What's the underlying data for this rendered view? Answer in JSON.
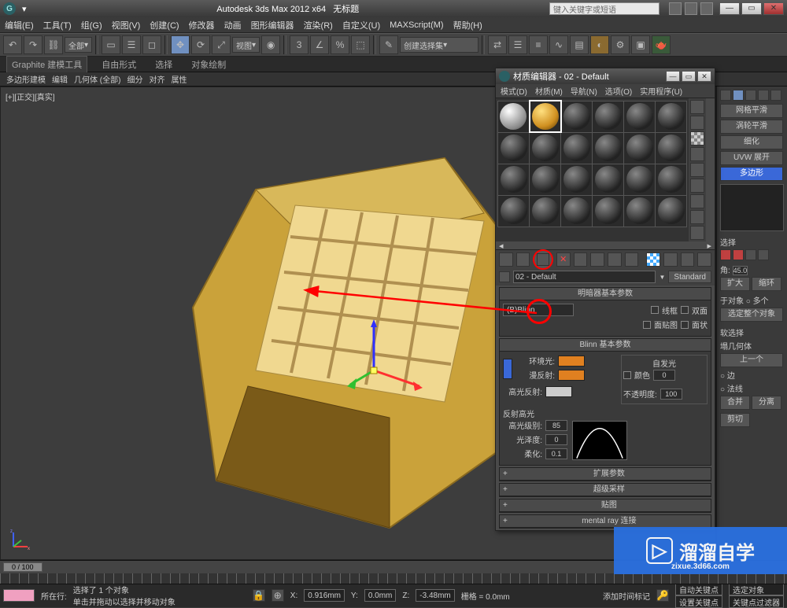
{
  "app": {
    "title": "Autodesk 3ds Max  2012 x64",
    "doc": "无标题",
    "search_placeholder": "键入关键字或短语"
  },
  "menubar": [
    "编辑(E)",
    "工具(T)",
    "组(G)",
    "视图(V)",
    "创建(C)",
    "修改器",
    "动画",
    "图形编辑器",
    "渲染(R)",
    "自定义(U)",
    "MAXScript(M)",
    "帮助(H)"
  ],
  "toolbar": {
    "dropdown1": "全部",
    "dropdown2": "视图",
    "dropdown3": "创建选择集"
  },
  "tabs": {
    "row1": [
      "Graphite 建模工具",
      "自由形式",
      "选择",
      "对象绘制"
    ],
    "row2": [
      "多边形建模",
      "编辑",
      "几何体 (全部)",
      "细分",
      "对齐",
      "属性"
    ]
  },
  "viewport": {
    "label": "[+][正交][真实]",
    "axis": [
      "x",
      "y",
      "z"
    ]
  },
  "material_editor": {
    "title": "材质编辑器 - 02 - Default",
    "menus": [
      "模式(D)",
      "材质(M)",
      "导航(N)",
      "选项(O)",
      "实用程序(U)"
    ],
    "current_name": "02 - Default",
    "type_button": "Standard",
    "rollouts": {
      "shader": {
        "title": "明暗器基本参数",
        "shader_name": "(B)Blinn",
        "checks": [
          "线框",
          "双面",
          "面贴图",
          "面状"
        ]
      },
      "blinn": {
        "title": "Blinn 基本参数",
        "ambient": "环境光:",
        "diffuse": "漫反射:",
        "specular": "高光反射:",
        "self_illum_label": "自发光",
        "color_label": "颜色",
        "color_val": "0",
        "opacity_label": "不透明度:",
        "opacity_val": "100",
        "highlights_label": "反射高光",
        "spec_level_label": "高光级别:",
        "spec_level_val": "85",
        "gloss_label": "光泽度:",
        "gloss_val": "0",
        "soften_label": "柔化:",
        "soften_val": "0.1"
      },
      "extended": "扩展参数",
      "supersampling": "超级采样",
      "maps": "贴图",
      "mentalray": "mental ray 连接"
    }
  },
  "right_panel": {
    "buttons": [
      "网格平滑",
      "涡轮平滑",
      "细化",
      "UVW 展开"
    ],
    "selected": "多边形",
    "modifier_head": "选择",
    "angle_label": "角:",
    "angle_val": "45.0",
    "btns2": [
      "扩大",
      "缩环"
    ],
    "to_obj_label": "于对象",
    "to_obj_opts": "多个",
    "select_whole": "选定整个对象",
    "soft_sel": "软选择",
    "geom_label": "塌几何体",
    "top_one": "上一个",
    "sub_edge": "边",
    "sub_face": "法线",
    "more_btns": [
      "合并",
      "分离",
      "剪切"
    ]
  },
  "status": {
    "timeline_label": "0 / 100",
    "sel_info": "选择了 1 个对象",
    "prompt": "单击并拖动以选择并移动对象",
    "x_label": "X:",
    "x_val": "0.916mm",
    "y_label": "Y:",
    "y_val": "0.0mm",
    "z_label": "Z:",
    "z_val": "-3.48mm",
    "grid_label": "栅格 = 0.0mm",
    "autokey": "自动关键点",
    "selected_set": "选定对象",
    "setkey": "设置关键点",
    "keyfilter": "关键点过滤器",
    "addtime": "添加时间标记",
    "nowplaying": "所在行:"
  },
  "watermark": {
    "brand": "溜溜自学",
    "url": "zixue.3d66.com"
  }
}
